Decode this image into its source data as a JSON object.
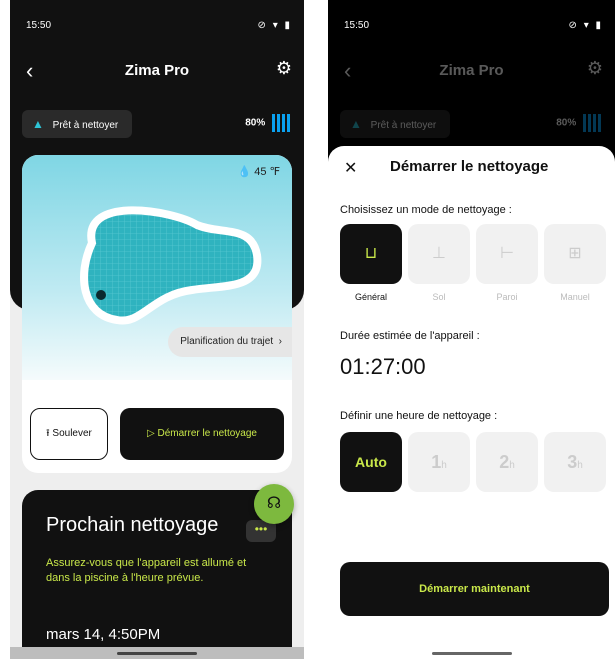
{
  "left": {
    "status_time": "15:50",
    "status_icons": "⊘ ▾ ▮",
    "app_title": "Zima Pro",
    "device_status": "Prêt à nettoyer",
    "battery": "80%",
    "temperature": "45 ℉",
    "plan_label": "Planification du trajet",
    "lift_label": "Soulever",
    "start_label": "Démarrer le nettoyage",
    "next_title": "Prochain nettoyage",
    "next_message": "Assurez-vous que l'appareil est allumé et dans la piscine à l'heure prévue.",
    "next_date": "mars 14, 4:50PM",
    "more": "•••"
  },
  "right": {
    "status_time": "15:50",
    "status_icons": "⊘ ▾ ▮",
    "app_title": "Zima Pro",
    "device_status": "Prêt à nettoyer",
    "battery": "80%",
    "sheet_title": "Démarrer le nettoyage",
    "mode_prompt": "Choisissez un mode de nettoyage :",
    "modes": [
      {
        "label": "Général",
        "icon": "⊔"
      },
      {
        "label": "Sol",
        "icon": "⊥"
      },
      {
        "label": "Paroi",
        "icon": "⊢"
      },
      {
        "label": "Manuel",
        "icon": "⊞"
      }
    ],
    "duration_label": "Durée estimée de l'appareil :",
    "duration": "01:27:00",
    "time_label": "Définir une heure de nettoyage :",
    "times": [
      {
        "main": "Auto",
        "unit": ""
      },
      {
        "main": "1",
        "unit": "h"
      },
      {
        "main": "2",
        "unit": "h"
      },
      {
        "main": "3",
        "unit": "h"
      }
    ],
    "start_now": "Démarrer maintenant"
  },
  "colors": {
    "accent": "#c9e84a",
    "dark": "#111111",
    "battery": "#0aa1f0",
    "pool": "#7fd6e4"
  }
}
